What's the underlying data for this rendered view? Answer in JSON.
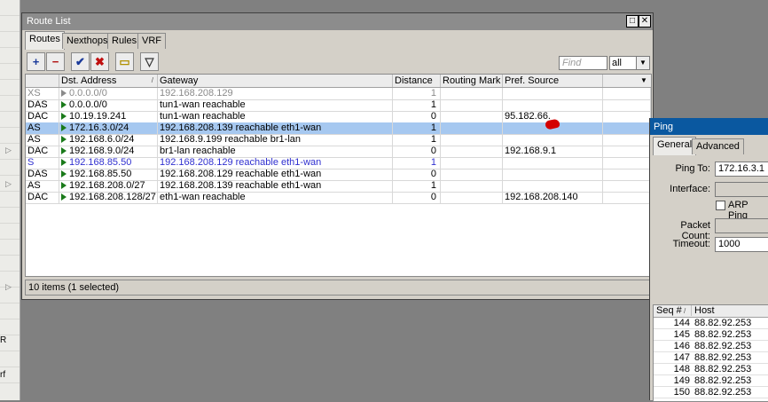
{
  "left_strip": {
    "labels": [
      "R",
      "rf"
    ]
  },
  "route_window": {
    "title": "Route List",
    "tabs": [
      "Routes",
      "Nexthops",
      "Rules",
      "VRF"
    ],
    "toolbar": {
      "add": "+",
      "remove": "−",
      "enable": "✔",
      "disable": "✖",
      "comment": "▭",
      "filter": "▽"
    },
    "find_placeholder": "Find",
    "filter_value": "all",
    "columns": [
      "",
      "Dst. Address",
      "Gateway",
      "Distance",
      "Routing Mark",
      "Pref. Source"
    ],
    "rows": [
      {
        "flags": "XS",
        "dst": "0.0.0.0/0",
        "gw": "192.168.208.129",
        "dist": "1",
        "mark": "",
        "pref": "",
        "style": "gray",
        "flag_color": "gray"
      },
      {
        "flags": "DAS",
        "dst": "0.0.0.0/0",
        "gw": "tun1-wan reachable",
        "dist": "1",
        "mark": "",
        "pref": "",
        "style": "normal",
        "flag_color": "green"
      },
      {
        "flags": "DAC",
        "dst": "10.19.19.241",
        "gw": "tun1-wan reachable",
        "dist": "0",
        "mark": "",
        "pref": "95.182.66.",
        "style": "normal",
        "flag_color": "green"
      },
      {
        "flags": "AS",
        "dst": "172.16.3.0/24",
        "gw": "192.168.208.139 reachable eth1-wan",
        "dist": "1",
        "mark": "",
        "pref": "",
        "style": "selected",
        "flag_color": "green"
      },
      {
        "flags": "AS",
        "dst": "192.168.6.0/24",
        "gw": "192.168.9.199 reachable br1-lan",
        "dist": "1",
        "mark": "",
        "pref": "",
        "style": "normal",
        "flag_color": "green"
      },
      {
        "flags": "DAC",
        "dst": "192.168.9.0/24",
        "gw": "br1-lan reachable",
        "dist": "0",
        "mark": "",
        "pref": "192.168.9.1",
        "style": "normal",
        "flag_color": "green"
      },
      {
        "flags": "S",
        "dst": "192.168.85.50",
        "gw": "192.168.208.129 reachable eth1-wan",
        "dist": "1",
        "mark": "",
        "pref": "",
        "style": "blue",
        "flag_color": "green"
      },
      {
        "flags": "DAS",
        "dst": "192.168.85.50",
        "gw": "192.168.208.129 reachable eth1-wan",
        "dist": "0",
        "mark": "",
        "pref": "",
        "style": "normal",
        "flag_color": "green"
      },
      {
        "flags": "AS",
        "dst": "192.168.208.0/27",
        "gw": "192.168.208.139 reachable eth1-wan",
        "dist": "1",
        "mark": "",
        "pref": "",
        "style": "normal",
        "flag_color": "green"
      },
      {
        "flags": "DAC",
        "dst": "192.168.208.128/27",
        "gw": "eth1-wan reachable",
        "dist": "0",
        "mark": "",
        "pref": "192.168.208.140",
        "style": "normal",
        "flag_color": "green"
      }
    ],
    "status": "10 items (1 selected)"
  },
  "ping_window": {
    "title": "Ping",
    "tabs": [
      "General",
      "Advanced"
    ],
    "ping_to_label": "Ping To:",
    "ping_to_value": "172.16.3.1",
    "interface_label": "Interface:",
    "arp_ping_label": "ARP Ping",
    "packet_count_label": "Packet Count:",
    "timeout_label": "Timeout:",
    "timeout_value": "1000",
    "columns": [
      "Seq #",
      "Host"
    ],
    "results": [
      {
        "seq": "144",
        "host": "88.82.92.253"
      },
      {
        "seq": "145",
        "host": "88.82.92.253"
      },
      {
        "seq": "146",
        "host": "88.82.92.253"
      },
      {
        "seq": "147",
        "host": "88.82.92.253"
      },
      {
        "seq": "148",
        "host": "88.82.92.253"
      },
      {
        "seq": "149",
        "host": "88.82.92.253"
      },
      {
        "seq": "150",
        "host": "88.82.92.253"
      }
    ]
  },
  "colors": {
    "selected_row": "#a6c8f0",
    "gray_text": "#8a8a8a",
    "blue_text": "#3030d0",
    "ping_title": "#0a58a0"
  }
}
